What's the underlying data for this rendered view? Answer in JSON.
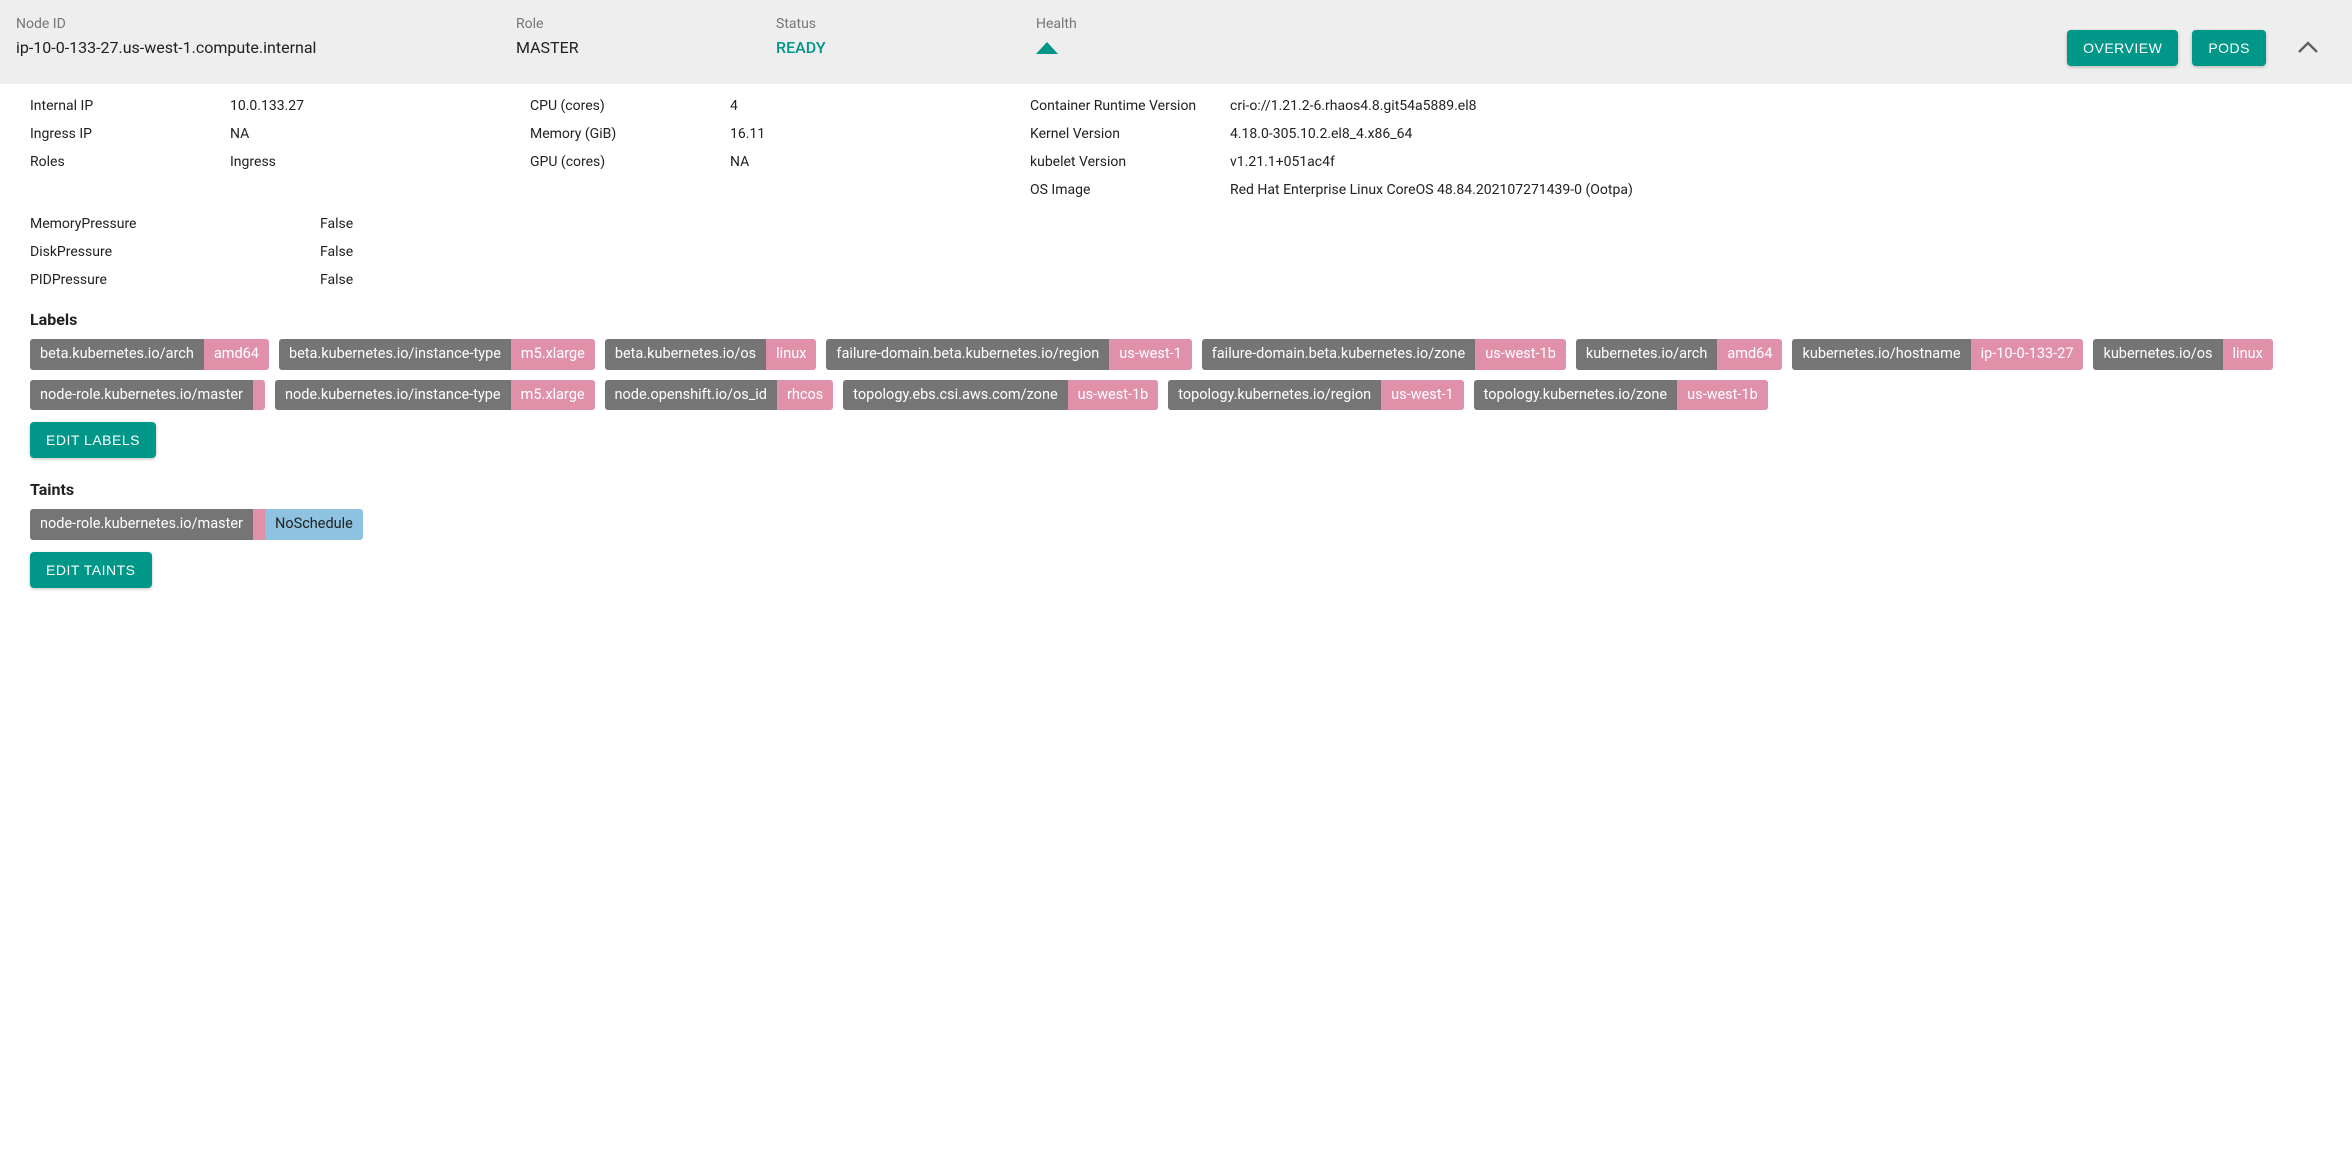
{
  "header": {
    "node_id_label": "Node ID",
    "node_id_value": "ip-10-0-133-27.us-west-1.compute.internal",
    "role_label": "Role",
    "role_value": "MASTER",
    "status_label": "Status",
    "status_value": "READY",
    "health_label": "Health",
    "buttons": {
      "overview": "OVERVIEW",
      "pods": "PODS"
    }
  },
  "details": {
    "col1": [
      {
        "label": "Internal IP",
        "value": "10.0.133.27"
      },
      {
        "label": "Ingress IP",
        "value": "NA"
      },
      {
        "label": "Roles",
        "value": "Ingress"
      }
    ],
    "col2": [
      {
        "label": "CPU (cores)",
        "value": "4"
      },
      {
        "label": "Memory (GiB)",
        "value": "16.11"
      },
      {
        "label": "GPU (cores)",
        "value": "NA"
      }
    ],
    "col3": [
      {
        "label": "Container Runtime Version",
        "value": "cri-o://1.21.2-6.rhaos4.8.git54a5889.el8"
      },
      {
        "label": "Kernel Version",
        "value": "4.18.0-305.10.2.el8_4.x86_64"
      },
      {
        "label": "kubelet Version",
        "value": "v1.21.1+051ac4f"
      },
      {
        "label": "OS Image",
        "value": "Red Hat Enterprise Linux CoreOS 48.84.202107271439-0 (Ootpa)"
      }
    ]
  },
  "conditions": [
    {
      "label": "MemoryPressure",
      "value": "False"
    },
    {
      "label": "DiskPressure",
      "value": "False"
    },
    {
      "label": "PIDPressure",
      "value": "False"
    }
  ],
  "labels_section": {
    "title": "Labels",
    "items": [
      {
        "key": "beta.kubernetes.io/arch",
        "value": "amd64"
      },
      {
        "key": "beta.kubernetes.io/instance-type",
        "value": "m5.xlarge"
      },
      {
        "key": "beta.kubernetes.io/os",
        "value": "linux"
      },
      {
        "key": "failure-domain.beta.kubernetes.io/region",
        "value": "us-west-1"
      },
      {
        "key": "failure-domain.beta.kubernetes.io/zone",
        "value": "us-west-1b"
      },
      {
        "key": "kubernetes.io/arch",
        "value": "amd64"
      },
      {
        "key": "kubernetes.io/hostname",
        "value": "ip-10-0-133-27"
      },
      {
        "key": "kubernetes.io/os",
        "value": "linux"
      },
      {
        "key": "node-role.kubernetes.io/master",
        "value": ""
      },
      {
        "key": "node.kubernetes.io/instance-type",
        "value": "m5.xlarge"
      },
      {
        "key": "node.openshift.io/os_id",
        "value": "rhcos"
      },
      {
        "key": "topology.ebs.csi.aws.com/zone",
        "value": "us-west-1b"
      },
      {
        "key": "topology.kubernetes.io/region",
        "value": "us-west-1"
      },
      {
        "key": "topology.kubernetes.io/zone",
        "value": "us-west-1b"
      }
    ],
    "edit": "EDIT LABELS"
  },
  "taints_section": {
    "title": "Taints",
    "items": [
      {
        "key": "node-role.kubernetes.io/master",
        "value": "",
        "effect": "NoSchedule"
      }
    ],
    "edit": "EDIT TAINTS"
  }
}
